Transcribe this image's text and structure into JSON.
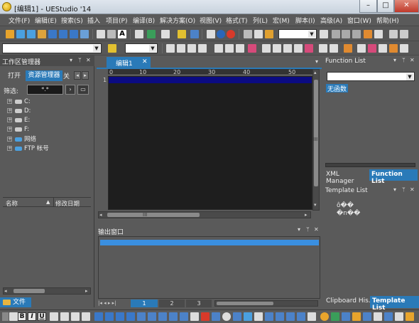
{
  "window": {
    "title": "[编辑1] - UEStudio '14",
    "minimize": "–",
    "maximize": "□",
    "close": "✕"
  },
  "menu": [
    {
      "label": "文件(F)"
    },
    {
      "label": "编辑(E)"
    },
    {
      "label": "搜索(S)"
    },
    {
      "label": "插入"
    },
    {
      "label": "项目(P)"
    },
    {
      "label": "编译(B)"
    },
    {
      "label": "解决方案(O)"
    },
    {
      "label": "视图(V)"
    },
    {
      "label": "格式(T)"
    },
    {
      "label": "列(L)"
    },
    {
      "label": "宏(M)"
    },
    {
      "label": "脚本(I)"
    },
    {
      "label": "高级(A)"
    },
    {
      "label": "窗口(W)"
    },
    {
      "label": "帮助(H)"
    }
  ],
  "left_panel": {
    "title": "工作区管理器",
    "tabs": [
      "打开",
      "资源管理器",
      "关"
    ],
    "filter_label": "筛选:",
    "filter_value": "*.*",
    "tree": [
      "C:",
      "D:",
      "E:",
      "F:",
      "网络",
      "FTP 帐号"
    ],
    "columns": [
      "名称",
      "修改日期"
    ],
    "bottom_tab": "文件"
  },
  "editor": {
    "tab_label": "编辑1",
    "ruler_labels": [
      "0",
      "10",
      "20",
      "30",
      "40",
      "50"
    ],
    "line_number": "1",
    "scroll_grip": "III"
  },
  "output_panel": {
    "title": "输出窗口",
    "pages": [
      "1",
      "2",
      "3"
    ]
  },
  "function_list": {
    "title": "Function List",
    "empty_item": "无函数",
    "tabs": [
      "XML Manager",
      "Function List"
    ]
  },
  "template_list": {
    "title": "Template List",
    "items": [
      "ô��",
      "�n��"
    ],
    "tabs": [
      "Clipboard His...",
      "Template List"
    ]
  },
  "panel_controls": {
    "dropdown": "▾",
    "pin": "ᛘ",
    "close": "✕"
  },
  "bottom_toolbar": {
    "bold": "B",
    "italic": "I",
    "underline": "U"
  },
  "colors": {
    "accent": "#2a7ab8",
    "editor_bg": "#1e1e1e",
    "current_line": "#0b0b82",
    "output_highlight": "#3a8fe0"
  }
}
